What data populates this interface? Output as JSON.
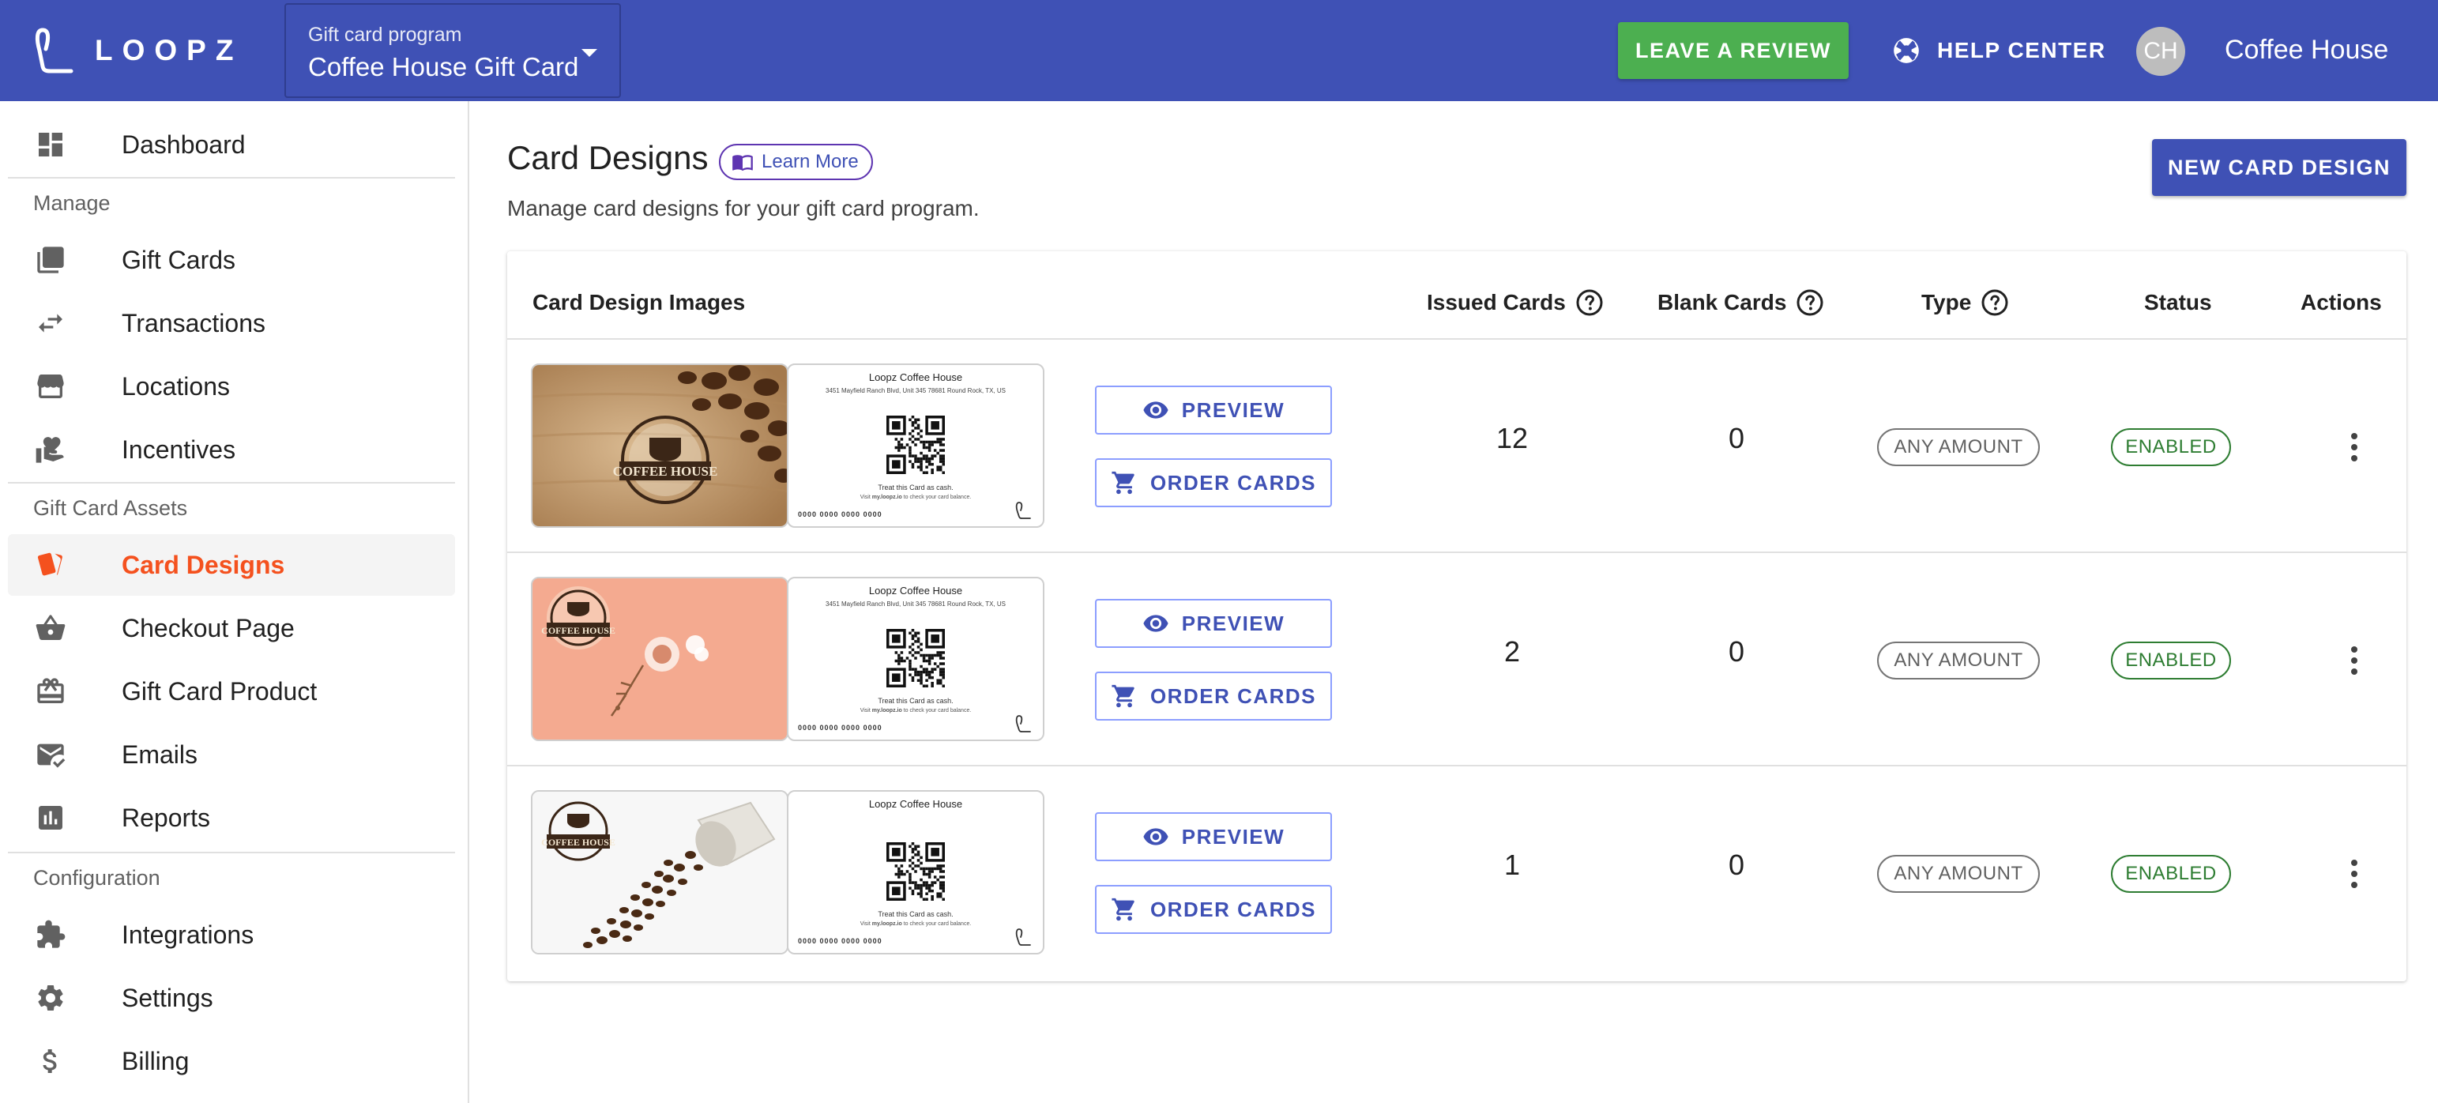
{
  "header": {
    "logo_text": "LOOPZ",
    "program_label": "Gift card program",
    "program_value": "Coffee House Gift Card",
    "review_label": "LEAVE A REVIEW",
    "help_label": "HELP CENTER",
    "avatar_initials": "CH",
    "account_name": "Coffee House",
    "brand_color": "#3f51b5",
    "review_color": "#4caf50"
  },
  "sidebar": {
    "dashboard": "Dashboard",
    "section_manage": "Manage",
    "gift_cards": "Gift Cards",
    "transactions": "Transactions",
    "locations": "Locations",
    "incentives": "Incentives",
    "section_assets": "Gift Card Assets",
    "card_designs": "Card Designs",
    "checkout_page": "Checkout Page",
    "gift_card_product": "Gift Card Product",
    "emails": "Emails",
    "reports": "Reports",
    "section_config": "Configuration",
    "integrations": "Integrations",
    "settings": "Settings",
    "billing": "Billing",
    "active_item": "Card Designs",
    "active_color": "#f4511e"
  },
  "main": {
    "title": "Card Designs",
    "learn_more": "Learn More",
    "subtitle": "Manage card designs for your gift card program.",
    "new_button": "NEW CARD DESIGN",
    "columns": {
      "images": "Card Design Images",
      "issued": "Issued Cards",
      "blank": "Blank Cards",
      "type": "Type",
      "status": "Status",
      "actions": "Actions"
    },
    "preview_label": "PREVIEW",
    "order_label": "ORDER CARDS",
    "card_back": {
      "name": "Loopz Coffee House",
      "address": "3451 Mayfield Ranch Blvd, Unit 345 78681 Round Rock, TX, US",
      "cash_text": "Treat this Card as cash.",
      "visit_prefix": "Visit ",
      "visit_domain": "my.loopz.io",
      "visit_suffix": " to check your card balance.",
      "number": "0000 0000 0000 0000"
    },
    "rows": [
      {
        "front_label": "COFFEE HOUSE",
        "issued": "12",
        "blank": "0",
        "type": "ANY AMOUNT",
        "status": "ENABLED",
        "show_address": true
      },
      {
        "front_label": "COFFEE HOUSE",
        "issued": "2",
        "blank": "0",
        "type": "ANY AMOUNT",
        "status": "ENABLED",
        "show_address": true
      },
      {
        "front_label": "COFFEE HOUSE",
        "issued": "1",
        "blank": "0",
        "type": "ANY AMOUNT",
        "status": "ENABLED",
        "show_address": false
      }
    ]
  }
}
